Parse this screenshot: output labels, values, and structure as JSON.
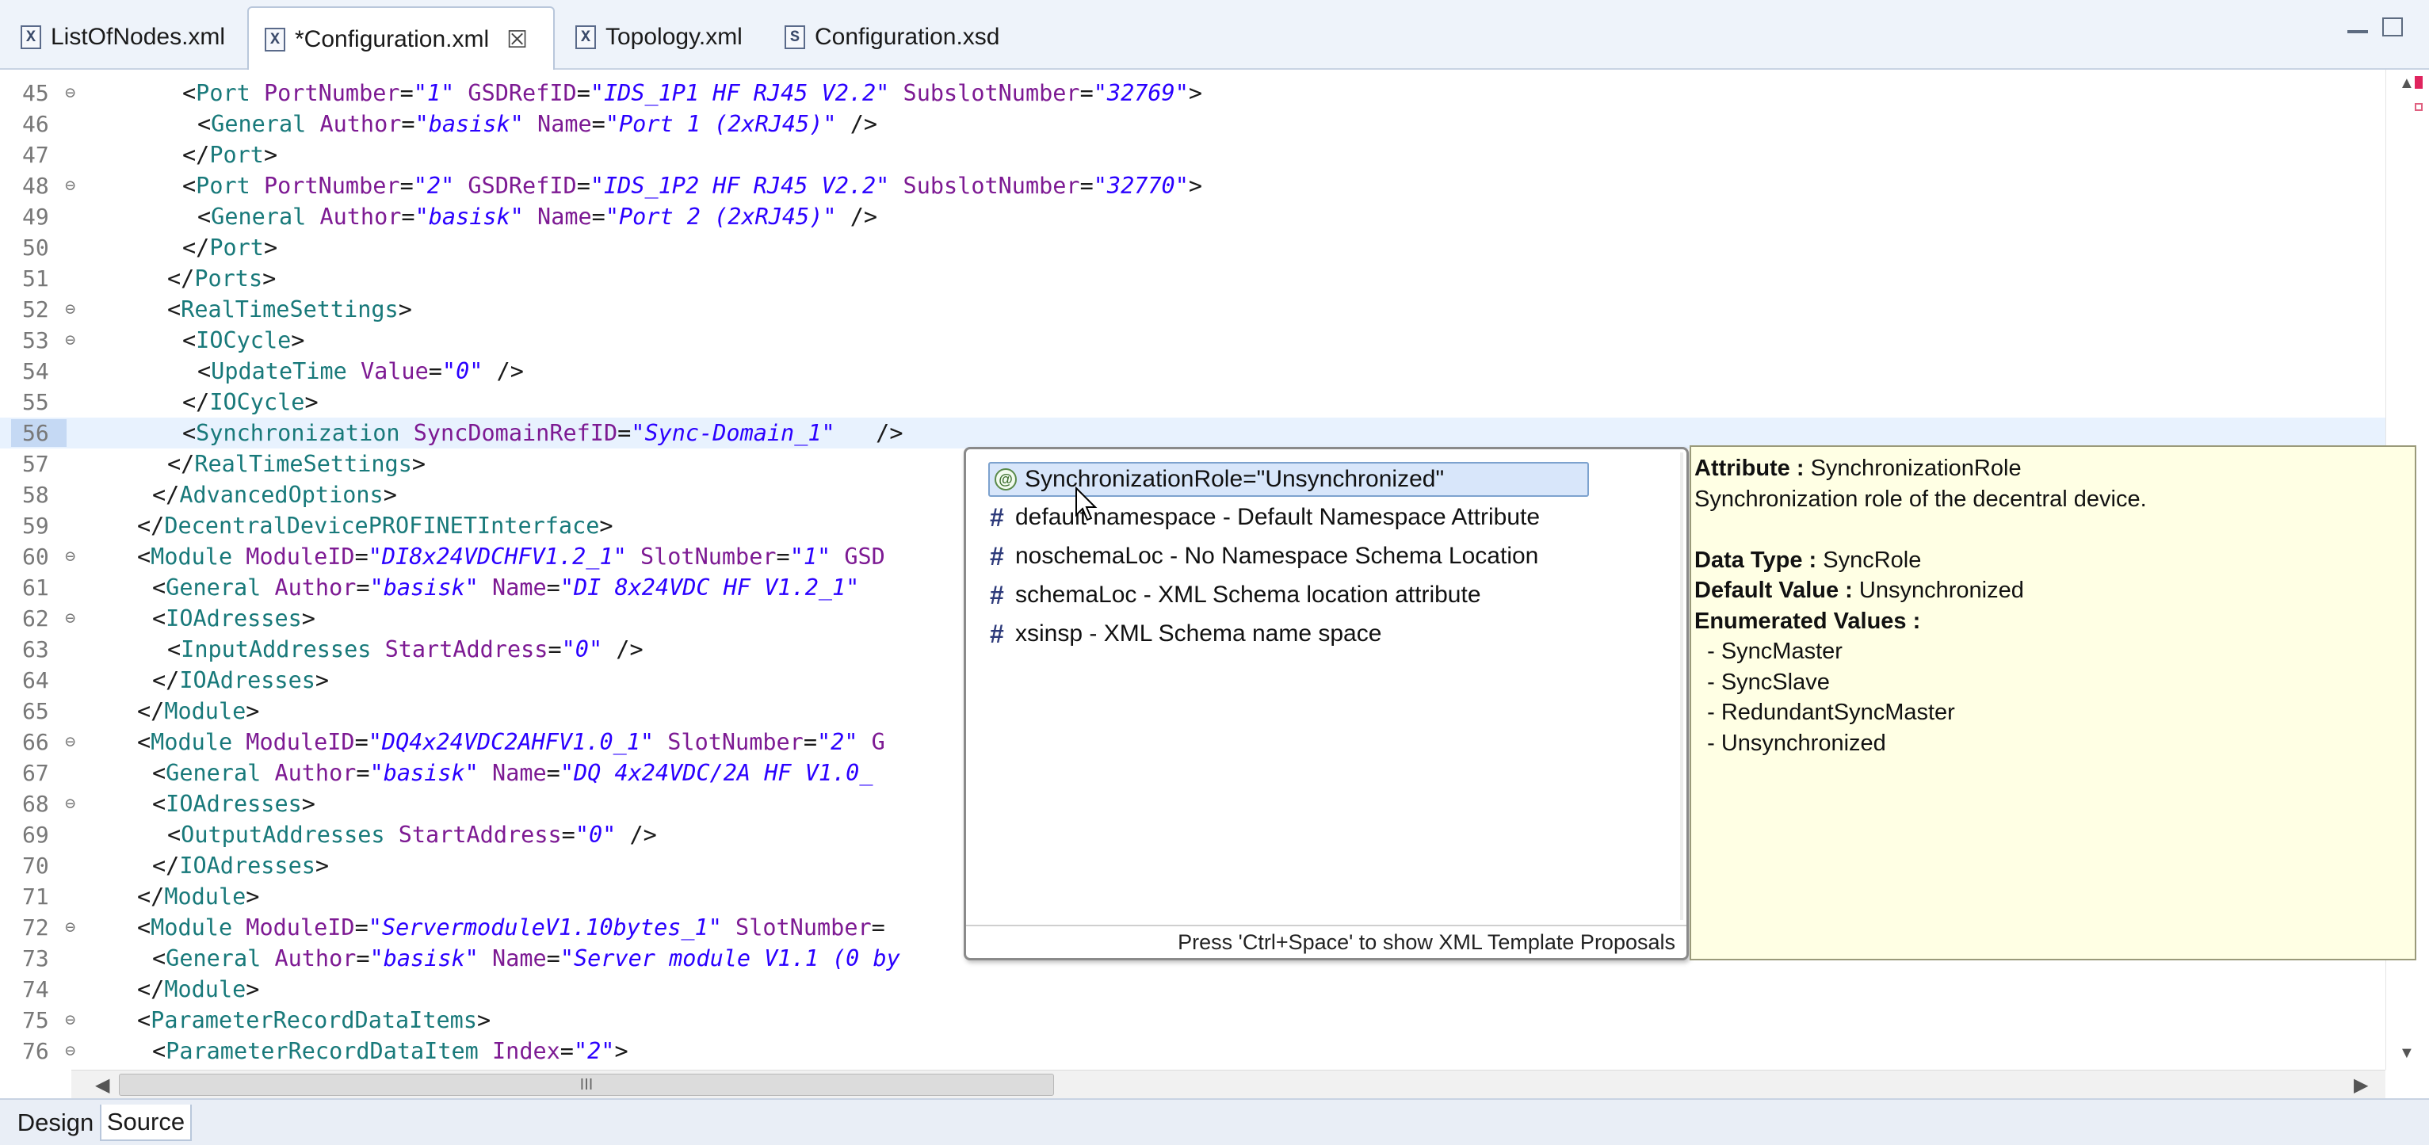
{
  "tabs": [
    {
      "label": "ListOfNodes.xml",
      "icon": "X",
      "active": false,
      "close": ""
    },
    {
      "label": "*Configuration.xml",
      "icon": "X",
      "active": true,
      "close": "☒"
    },
    {
      "label": "Topology.xml",
      "icon": "X",
      "active": false,
      "close": ""
    },
    {
      "label": "Configuration.xsd",
      "icon": "S",
      "active": false,
      "close": ""
    }
  ],
  "editor": {
    "current_line": "56",
    "lines": [
      {
        "num": "45",
        "fold": true,
        "indent": 6,
        "tokens": [
          [
            "p",
            "<"
          ],
          [
            "t",
            "Port"
          ],
          [
            "p",
            " "
          ],
          [
            "a",
            "PortNumber"
          ],
          [
            "p",
            "="
          ],
          [
            "v",
            "\"1\""
          ],
          [
            "p",
            " "
          ],
          [
            "a",
            "GSDRefID"
          ],
          [
            "p",
            "="
          ],
          [
            "v",
            "\"IDS_1P1 HF RJ45 V2.2\""
          ],
          [
            "p",
            " "
          ],
          [
            "a",
            "SubslotNumber"
          ],
          [
            "p",
            "="
          ],
          [
            "v",
            "\"32769\""
          ],
          [
            "p",
            ">"
          ]
        ]
      },
      {
        "num": "46",
        "fold": false,
        "indent": 7,
        "tokens": [
          [
            "p",
            "<"
          ],
          [
            "t",
            "General"
          ],
          [
            "p",
            " "
          ],
          [
            "a",
            "Author"
          ],
          [
            "p",
            "="
          ],
          [
            "v",
            "\"basisk\""
          ],
          [
            "p",
            " "
          ],
          [
            "a",
            "Name"
          ],
          [
            "p",
            "="
          ],
          [
            "v",
            "\"Port 1 (2xRJ45)\""
          ],
          [
            "p",
            " />"
          ]
        ]
      },
      {
        "num": "47",
        "fold": false,
        "indent": 6,
        "tokens": [
          [
            "p",
            "</"
          ],
          [
            "t",
            "Port"
          ],
          [
            "p",
            ">"
          ]
        ]
      },
      {
        "num": "48",
        "fold": true,
        "indent": 6,
        "tokens": [
          [
            "p",
            "<"
          ],
          [
            "t",
            "Port"
          ],
          [
            "p",
            " "
          ],
          [
            "a",
            "PortNumber"
          ],
          [
            "p",
            "="
          ],
          [
            "v",
            "\"2\""
          ],
          [
            "p",
            " "
          ],
          [
            "a",
            "GSDRefID"
          ],
          [
            "p",
            "="
          ],
          [
            "v",
            "\"IDS_1P2 HF RJ45 V2.2\""
          ],
          [
            "p",
            " "
          ],
          [
            "a",
            "SubslotNumber"
          ],
          [
            "p",
            "="
          ],
          [
            "v",
            "\"32770\""
          ],
          [
            "p",
            ">"
          ]
        ]
      },
      {
        "num": "49",
        "fold": false,
        "indent": 7,
        "tokens": [
          [
            "p",
            "<"
          ],
          [
            "t",
            "General"
          ],
          [
            "p",
            " "
          ],
          [
            "a",
            "Author"
          ],
          [
            "p",
            "="
          ],
          [
            "v",
            "\"basisk\""
          ],
          [
            "p",
            " "
          ],
          [
            "a",
            "Name"
          ],
          [
            "p",
            "="
          ],
          [
            "v",
            "\"Port 2 (2xRJ45)\""
          ],
          [
            "p",
            " />"
          ]
        ]
      },
      {
        "num": "50",
        "fold": false,
        "indent": 6,
        "tokens": [
          [
            "p",
            "</"
          ],
          [
            "t",
            "Port"
          ],
          [
            "p",
            ">"
          ]
        ]
      },
      {
        "num": "51",
        "fold": false,
        "indent": 5,
        "tokens": [
          [
            "p",
            "</"
          ],
          [
            "t",
            "Ports"
          ],
          [
            "p",
            ">"
          ]
        ]
      },
      {
        "num": "52",
        "fold": true,
        "indent": 5,
        "tokens": [
          [
            "p",
            "<"
          ],
          [
            "t",
            "RealTimeSettings"
          ],
          [
            "p",
            ">"
          ]
        ]
      },
      {
        "num": "53",
        "fold": true,
        "indent": 6,
        "tokens": [
          [
            "p",
            "<"
          ],
          [
            "t",
            "IOCycle"
          ],
          [
            "p",
            ">"
          ]
        ]
      },
      {
        "num": "54",
        "fold": false,
        "indent": 7,
        "tokens": [
          [
            "p",
            "<"
          ],
          [
            "t",
            "UpdateTime"
          ],
          [
            "p",
            " "
          ],
          [
            "a",
            "Value"
          ],
          [
            "p",
            "="
          ],
          [
            "v",
            "\"0\""
          ],
          [
            "p",
            " />"
          ]
        ]
      },
      {
        "num": "55",
        "fold": false,
        "indent": 6,
        "tokens": [
          [
            "p",
            "</"
          ],
          [
            "t",
            "IOCycle"
          ],
          [
            "p",
            ">"
          ]
        ]
      },
      {
        "num": "56",
        "fold": false,
        "indent": 6,
        "tokens": [
          [
            "p",
            "<"
          ],
          [
            "t",
            "Synchronization"
          ],
          [
            "p",
            " "
          ],
          [
            "a",
            "SyncDomainRefID"
          ],
          [
            "p",
            "="
          ],
          [
            "v",
            "\"Sync-Domain_1\""
          ],
          [
            "p",
            "   />"
          ]
        ]
      },
      {
        "num": "57",
        "fold": false,
        "indent": 5,
        "tokens": [
          [
            "p",
            "</"
          ],
          [
            "t",
            "RealTimeSettings"
          ],
          [
            "p",
            ">"
          ]
        ]
      },
      {
        "num": "58",
        "fold": false,
        "indent": 4,
        "tokens": [
          [
            "p",
            "</"
          ],
          [
            "t",
            "AdvancedOptions"
          ],
          [
            "p",
            ">"
          ]
        ]
      },
      {
        "num": "59",
        "fold": false,
        "indent": 3,
        "tokens": [
          [
            "p",
            "</"
          ],
          [
            "t",
            "DecentralDevicePROFINETInterface"
          ],
          [
            "p",
            ">"
          ]
        ]
      },
      {
        "num": "60",
        "fold": true,
        "indent": 3,
        "tokens": [
          [
            "p",
            "<"
          ],
          [
            "t",
            "Module"
          ],
          [
            "p",
            " "
          ],
          [
            "a",
            "ModuleID"
          ],
          [
            "p",
            "="
          ],
          [
            "v",
            "\"DI8x24VDCHFV1.2_1\""
          ],
          [
            "p",
            " "
          ],
          [
            "a",
            "SlotNumber"
          ],
          [
            "p",
            "="
          ],
          [
            "v",
            "\"1\""
          ],
          [
            "p",
            " "
          ],
          [
            "a",
            "GSD"
          ]
        ]
      },
      {
        "num": "61",
        "fold": false,
        "indent": 4,
        "tokens": [
          [
            "p",
            "<"
          ],
          [
            "t",
            "General"
          ],
          [
            "p",
            " "
          ],
          [
            "a",
            "Author"
          ],
          [
            "p",
            "="
          ],
          [
            "v",
            "\"basisk\""
          ],
          [
            "p",
            " "
          ],
          [
            "a",
            "Name"
          ],
          [
            "p",
            "="
          ],
          [
            "v",
            "\"DI 8x24VDC HF V1.2_1\""
          ]
        ]
      },
      {
        "num": "62",
        "fold": true,
        "indent": 4,
        "tokens": [
          [
            "p",
            "<"
          ],
          [
            "t",
            "IOAdresses"
          ],
          [
            "p",
            ">"
          ]
        ]
      },
      {
        "num": "63",
        "fold": false,
        "indent": 5,
        "tokens": [
          [
            "p",
            "<"
          ],
          [
            "t",
            "InputAddresses"
          ],
          [
            "p",
            " "
          ],
          [
            "a",
            "StartAddress"
          ],
          [
            "p",
            "="
          ],
          [
            "v",
            "\"0\""
          ],
          [
            "p",
            " />"
          ]
        ]
      },
      {
        "num": "64",
        "fold": false,
        "indent": 4,
        "tokens": [
          [
            "p",
            "</"
          ],
          [
            "t",
            "IOAdresses"
          ],
          [
            "p",
            ">"
          ]
        ]
      },
      {
        "num": "65",
        "fold": false,
        "indent": 3,
        "tokens": [
          [
            "p",
            "</"
          ],
          [
            "t",
            "Module"
          ],
          [
            "p",
            ">"
          ]
        ]
      },
      {
        "num": "66",
        "fold": true,
        "indent": 3,
        "tokens": [
          [
            "p",
            "<"
          ],
          [
            "t",
            "Module"
          ],
          [
            "p",
            " "
          ],
          [
            "a",
            "ModuleID"
          ],
          [
            "p",
            "="
          ],
          [
            "v",
            "\"DQ4x24VDC2AHFV1.0_1\""
          ],
          [
            "p",
            " "
          ],
          [
            "a",
            "SlotNumber"
          ],
          [
            "p",
            "="
          ],
          [
            "v",
            "\"2\""
          ],
          [
            "p",
            " "
          ],
          [
            "a",
            "G"
          ]
        ]
      },
      {
        "num": "67",
        "fold": false,
        "indent": 4,
        "tokens": [
          [
            "p",
            "<"
          ],
          [
            "t",
            "General"
          ],
          [
            "p",
            " "
          ],
          [
            "a",
            "Author"
          ],
          [
            "p",
            "="
          ],
          [
            "v",
            "\"basisk\""
          ],
          [
            "p",
            " "
          ],
          [
            "a",
            "Name"
          ],
          [
            "p",
            "="
          ],
          [
            "v",
            "\"DQ 4x24VDC/2A HF V1.0_"
          ]
        ]
      },
      {
        "num": "68",
        "fold": true,
        "indent": 4,
        "tokens": [
          [
            "p",
            "<"
          ],
          [
            "t",
            "IOAdresses"
          ],
          [
            "p",
            ">"
          ]
        ]
      },
      {
        "num": "69",
        "fold": false,
        "indent": 5,
        "tokens": [
          [
            "p",
            "<"
          ],
          [
            "t",
            "OutputAddresses"
          ],
          [
            "p",
            " "
          ],
          [
            "a",
            "StartAddress"
          ],
          [
            "p",
            "="
          ],
          [
            "v",
            "\"0\""
          ],
          [
            "p",
            " />"
          ]
        ]
      },
      {
        "num": "70",
        "fold": false,
        "indent": 4,
        "tokens": [
          [
            "p",
            "</"
          ],
          [
            "t",
            "IOAdresses"
          ],
          [
            "p",
            ">"
          ]
        ]
      },
      {
        "num": "71",
        "fold": false,
        "indent": 3,
        "tokens": [
          [
            "p",
            "</"
          ],
          [
            "t",
            "Module"
          ],
          [
            "p",
            ">"
          ]
        ]
      },
      {
        "num": "72",
        "fold": true,
        "indent": 3,
        "tokens": [
          [
            "p",
            "<"
          ],
          [
            "t",
            "Module"
          ],
          [
            "p",
            " "
          ],
          [
            "a",
            "ModuleID"
          ],
          [
            "p",
            "="
          ],
          [
            "v",
            "\"ServermoduleV1.10bytes_1\""
          ],
          [
            "p",
            " "
          ],
          [
            "a",
            "SlotNumber"
          ],
          [
            "p",
            "="
          ]
        ]
      },
      {
        "num": "73",
        "fold": false,
        "indent": 4,
        "tokens": [
          [
            "p",
            "<"
          ],
          [
            "t",
            "General"
          ],
          [
            "p",
            " "
          ],
          [
            "a",
            "Author"
          ],
          [
            "p",
            "="
          ],
          [
            "v",
            "\"basisk\""
          ],
          [
            "p",
            " "
          ],
          [
            "a",
            "Name"
          ],
          [
            "p",
            "="
          ],
          [
            "v",
            "\"Server module V1.1 (0 by"
          ]
        ]
      },
      {
        "num": "74",
        "fold": false,
        "indent": 3,
        "tokens": [
          [
            "p",
            "</"
          ],
          [
            "t",
            "Module"
          ],
          [
            "p",
            ">"
          ]
        ]
      },
      {
        "num": "75",
        "fold": true,
        "indent": 3,
        "tokens": [
          [
            "p",
            "<"
          ],
          [
            "t",
            "ParameterRecordDataItems"
          ],
          [
            "p",
            ">"
          ]
        ]
      },
      {
        "num": "76",
        "fold": true,
        "indent": 4,
        "tokens": [
          [
            "p",
            "<"
          ],
          [
            "t",
            "ParameterRecordDataItem"
          ],
          [
            "p",
            " "
          ],
          [
            "a",
            "Index"
          ],
          [
            "p",
            "="
          ],
          [
            "v",
            "\"2\""
          ],
          [
            "p",
            ">"
          ]
        ]
      }
    ]
  },
  "content_assist": {
    "proposals": [
      {
        "kind": "attribute",
        "label": "SynchronizationRole=\"Unsynchronized\"",
        "selected": true
      },
      {
        "kind": "namespace",
        "label": "default namespace - Default Namespace Attribute",
        "selected": false
      },
      {
        "kind": "namespace",
        "label": "noschemaLoc - No Namespace Schema Location",
        "selected": false
      },
      {
        "kind": "namespace",
        "label": "schemaLoc - XML Schema location attribute",
        "selected": false
      },
      {
        "kind": "namespace",
        "label": "xsinsp - XML Schema name space",
        "selected": false
      }
    ],
    "footer": "Press 'Ctrl+Space' to show XML Template Proposals",
    "attr_icon": "@",
    "ns_icon": "#"
  },
  "info": {
    "attribute_label": "Attribute :",
    "attribute_value": " SynchronizationRole",
    "description": "Synchronization role of the decentral device.",
    "data_type_label": "Data Type :",
    "data_type_value": " SyncRole",
    "default_label": "Default Value :",
    "default_value": " Unsynchronized",
    "enum_label": "Enumerated Values :",
    "enum_values": [
      "  - SyncMaster",
      "  - SyncSlave",
      "  - RedundantSyncMaster",
      "  - Unsynchronized"
    ]
  },
  "bottom_tabs": [
    {
      "label": "Design",
      "active": false
    },
    {
      "label": "Source",
      "active": true
    }
  ],
  "scroll_thumb_label": "III",
  "colors": {
    "tag": "#18797a",
    "attribute": "#7d1a93",
    "value": "#2a00ff",
    "current_line": "#e8f2fe",
    "popup_selection": "#d8e6fa",
    "info_bg": "#ffffe4"
  }
}
